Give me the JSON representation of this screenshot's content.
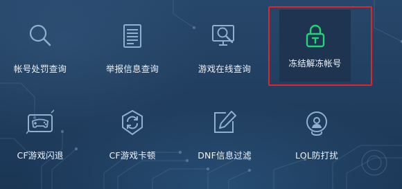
{
  "tools": [
    {
      "label": "帐号处罚查询",
      "icon": "search-icon"
    },
    {
      "label": "举报信息查询",
      "icon": "report-list-icon"
    },
    {
      "label": "游戏在线查询",
      "icon": "monitor-search-icon"
    },
    {
      "label": "冻结解冻帐号",
      "icon": "lock-icon",
      "selected": true
    },
    {
      "label": "CF游戏闪退",
      "icon": "gamepad-icon"
    },
    {
      "label": "CF游戏卡顿",
      "icon": "refresh-shield-icon"
    },
    {
      "label": "DNF信息过滤",
      "icon": "edit-icon"
    },
    {
      "label": "LOL防打扰",
      "icon": "shield-user-icon"
    }
  ],
  "colors": {
    "icon_stroke": "#8fb1cf",
    "active_icon": "#1fd67a",
    "highlight_border": "#e0262b",
    "background": "#223f60"
  }
}
